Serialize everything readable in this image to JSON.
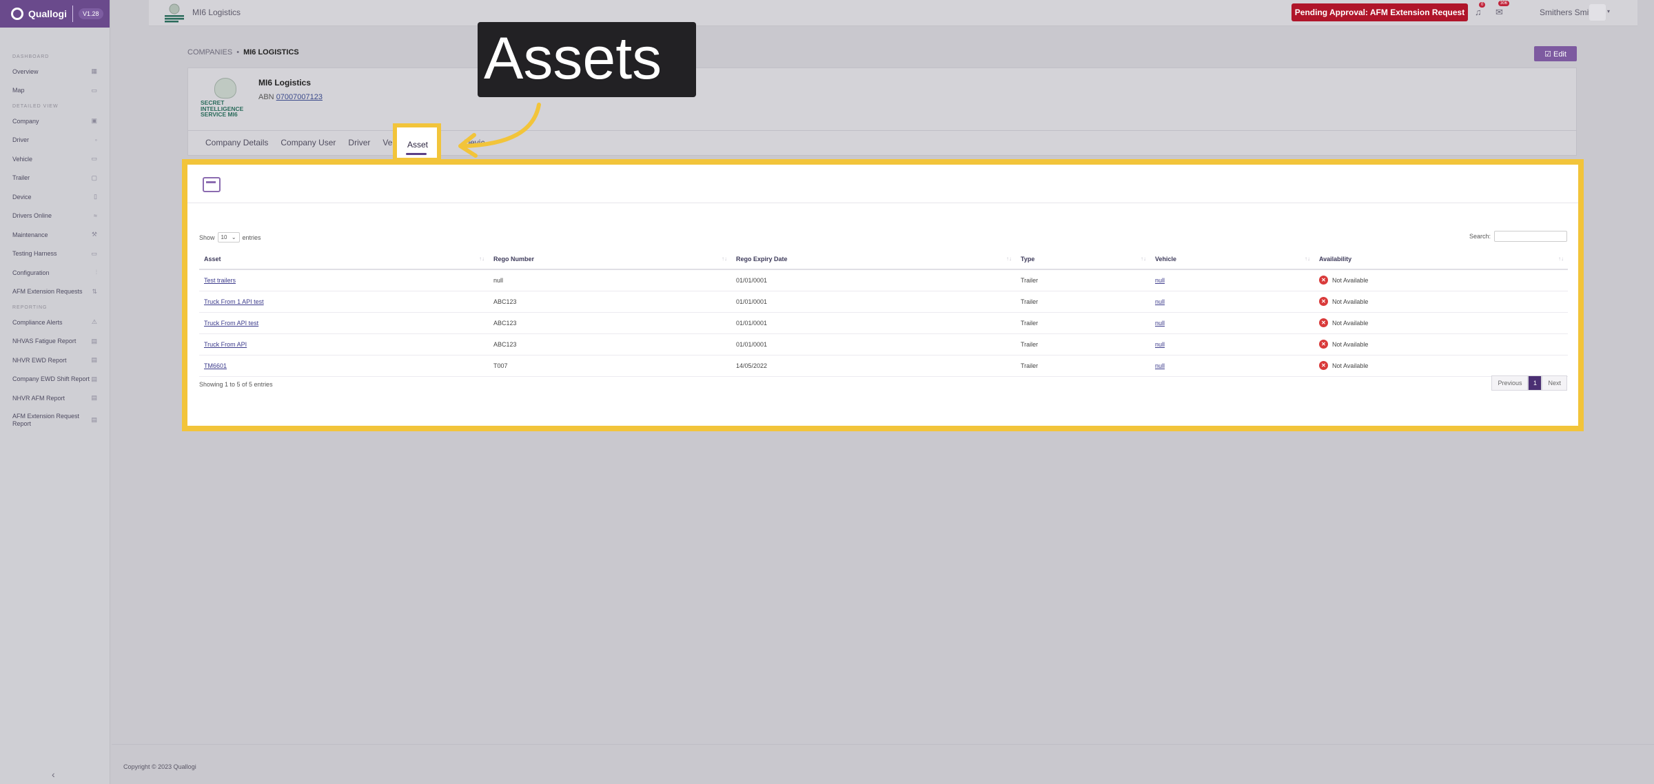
{
  "sidebar": {
    "brand": "Quallogi",
    "version": "V1.28",
    "sections": {
      "dashboard": "DASHBOARD",
      "detailed_view": "DETAILED VIEW",
      "reporting": "REPORTING"
    },
    "dashboard_items": [
      {
        "label": "Overview",
        "icon": "grid-icon"
      },
      {
        "label": "Map",
        "icon": "map-icon"
      }
    ],
    "detailed_items": [
      {
        "label": "Company",
        "icon": "briefcase-icon"
      },
      {
        "label": "Driver",
        "icon": "user-icon"
      },
      {
        "label": "Vehicle",
        "icon": "truck-icon"
      },
      {
        "label": "Trailer",
        "icon": "trailer-icon"
      },
      {
        "label": "Device",
        "icon": "mobile-icon"
      },
      {
        "label": "Drivers Online",
        "icon": "wifi-icon"
      },
      {
        "label": "Maintenance",
        "icon": "wrench-icon"
      },
      {
        "label": "Testing Harness",
        "icon": "monitor-icon"
      },
      {
        "label": "Configuration",
        "icon": "sliders-icon"
      },
      {
        "label": "AFM Extension Requests",
        "icon": "sort-icon"
      }
    ],
    "reporting_items": [
      {
        "label": "Compliance Alerts",
        "icon": "warning-icon"
      },
      {
        "label": "NHVAS Fatigue Report",
        "icon": "doc-icon"
      },
      {
        "label": "NHVR EWD Report",
        "icon": "doc-icon"
      },
      {
        "label": "Company EWD Shift Report",
        "icon": "doc-icon"
      },
      {
        "label": "NHVR AFM Report",
        "icon": "doc-icon"
      },
      {
        "label": "AFM Extension Request Report",
        "icon": "doc-icon"
      }
    ],
    "collapse": "‹"
  },
  "topbar": {
    "company": "MI6 Logistics",
    "pending_button": "Pending Approval: AFM Extension Request",
    "badge_1": "0",
    "badge_2": "306",
    "user": "Smithers Smith"
  },
  "breadcrumb": {
    "root": "COMPANIES",
    "sep": "•",
    "current": "MI6 LOGISTICS"
  },
  "edit_button": "☑ Edit",
  "company": {
    "name": "MI6 Logistics",
    "abn_label": "ABN",
    "abn_value": "07007007123",
    "logo_text": "SECRET INTELLIGENCE SERVICE MI6"
  },
  "tabs": [
    "Company Details",
    "Company User",
    "Driver",
    "Vehicl",
    "Asset",
    "Devic"
  ],
  "active_tab": "Asset",
  "callout": "Assets",
  "table": {
    "show": "Show",
    "entries_value": "10",
    "entries": "entries",
    "search_label": "Search:",
    "headers": [
      "Asset",
      "Rego Number",
      "Rego Expiry Date",
      "Type",
      "Vehicle",
      "Availability"
    ],
    "rows": [
      [
        "Test trailers",
        "null",
        "01/01/0001",
        "Trailer",
        "null",
        "Not Available"
      ],
      [
        "Truck From 1 API test",
        "ABC123",
        "01/01/0001",
        "Trailer",
        "null",
        "Not Available"
      ],
      [
        "Truck From API test",
        "ABC123",
        "01/01/0001",
        "Trailer",
        "null",
        "Not Available"
      ],
      [
        "Truck From API",
        "ABC123",
        "01/01/0001",
        "Trailer",
        "null",
        "Not Available"
      ],
      [
        "TM6601",
        "T007",
        "14/05/2022",
        "Trailer",
        "null",
        "Not Available"
      ]
    ],
    "info": "Showing 1 to 5 of 5 entries",
    "pager": {
      "previous": "Previous",
      "page": "1",
      "next": "Next"
    }
  },
  "footer": "Copyright © 2023 Quallogi",
  "colors": {
    "accent": "#5b3f86",
    "highlight": "#f2c43a",
    "danger": "#b0152a"
  }
}
